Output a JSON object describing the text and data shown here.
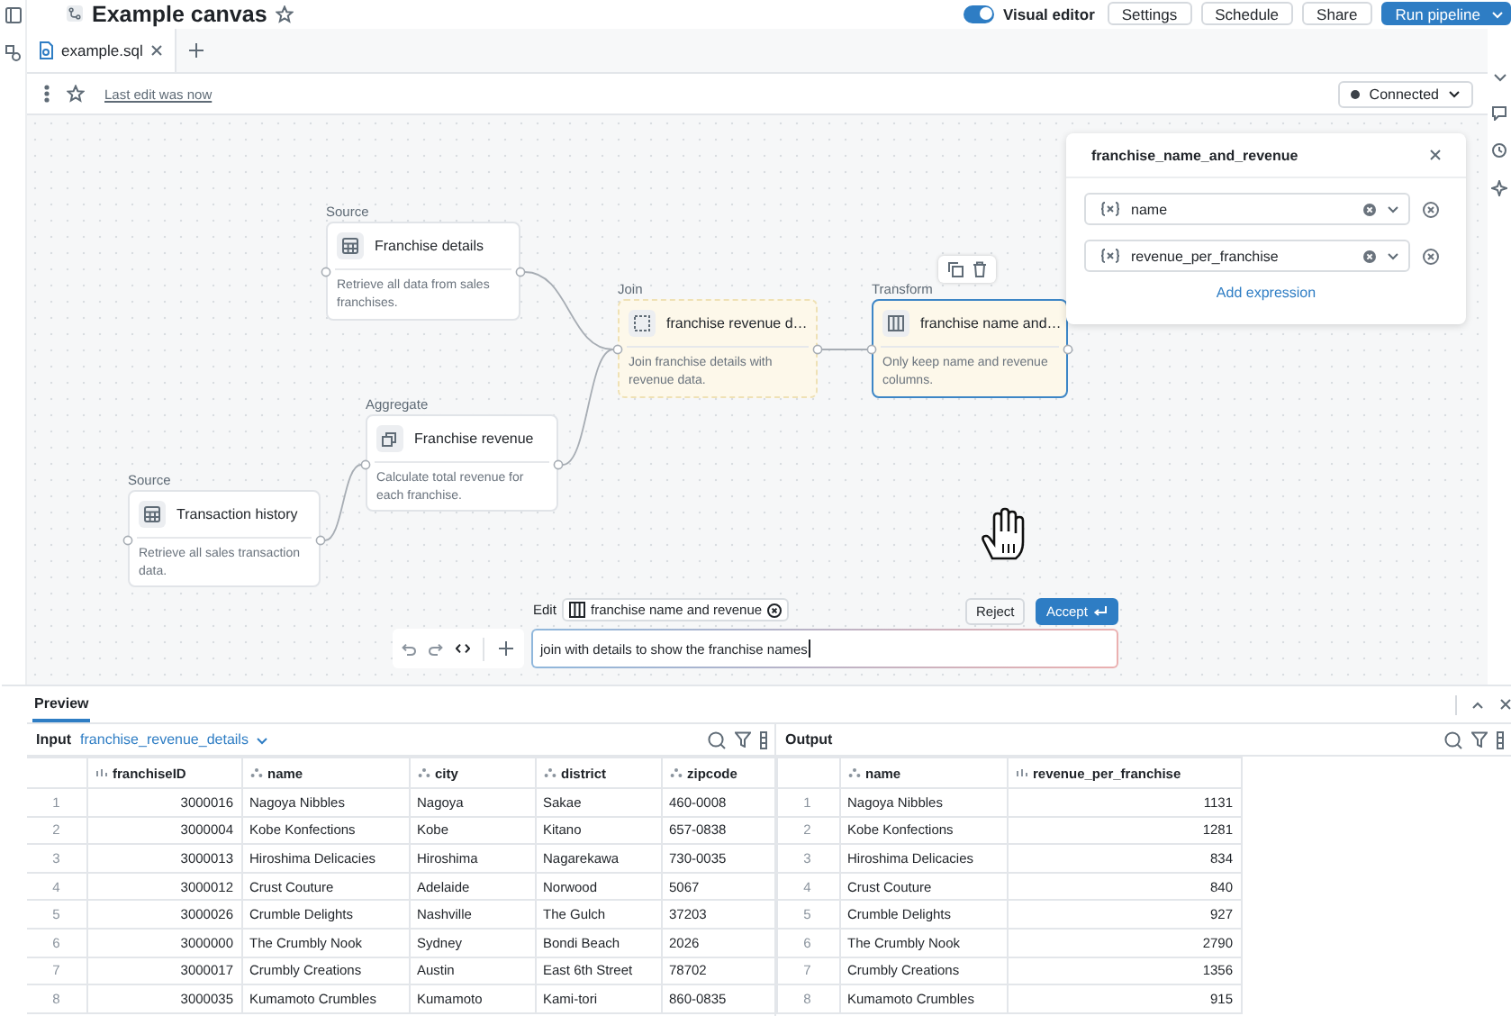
{
  "app": {
    "title": "Example canvas",
    "favorite": false,
    "visual_editor": {
      "label": "Visual editor",
      "on": true
    },
    "buttons": [
      {
        "label": "Settings",
        "kind": "default"
      },
      {
        "label": "Schedule",
        "kind": "default"
      },
      {
        "label": "Share",
        "kind": "default"
      },
      {
        "label": "Run pipeline",
        "kind": "primary"
      }
    ]
  },
  "tabs": [
    {
      "label": "example.sql",
      "selected": true
    }
  ],
  "toolbar": {
    "favorite": false,
    "last_edit": "Last edit was now",
    "connection": "Connected"
  },
  "canvas": {
    "nodes": [
      {
        "category": "Source",
        "title": "Franchise details",
        "description": "Retrieve all data from sales franchises.",
        "kind": "source",
        "pending": false,
        "selected": false
      },
      {
        "category": "Join",
        "title": "franchise revenue d…",
        "description": "Join franchise details with revenue data.",
        "kind": "join",
        "pending": true,
        "selected": false
      },
      {
        "category": "Transform",
        "title": "franchise name and…",
        "description": "Only keep name and revenue columns.",
        "kind": "transform",
        "pending": true,
        "selected": true
      },
      {
        "category": "Aggregate",
        "title": "Franchise revenue",
        "description": "Calculate total revenue for each franchise.",
        "kind": "aggregate",
        "pending": false,
        "selected": false
      },
      {
        "category": "Source",
        "title": "Transaction history",
        "description": "Retrieve all sales transaction data.",
        "kind": "source",
        "pending": false,
        "selected": false
      }
    ],
    "panel": {
      "title": "franchise_name_and_revenue",
      "expressions": [
        {
          "name": "name"
        },
        {
          "name": "revenue_per_franchise"
        }
      ],
      "add_label": "Add expression"
    },
    "edit": {
      "label": "Edit",
      "chip": "franchise name and revenue",
      "reject": "Reject",
      "accept": "Accept",
      "prompt": "join with details to show the franchise names"
    }
  },
  "preview": {
    "tabs": [
      {
        "label": "Preview",
        "selected": true
      }
    ],
    "input": {
      "label": "Input",
      "source": "franchise_revenue_details",
      "columns": [
        {
          "name": "franchiseID",
          "kind": "number"
        },
        {
          "name": "name",
          "kind": "string"
        },
        {
          "name": "city",
          "kind": "string"
        },
        {
          "name": "district",
          "kind": "string"
        },
        {
          "name": "zipcode",
          "kind": "string"
        }
      ],
      "rows": [
        {
          "number": "1",
          "cells": [
            "3000016",
            "Nagoya Nibbles",
            "Nagoya",
            "Sakae",
            "460-0008"
          ]
        },
        {
          "number": "2",
          "cells": [
            "3000004",
            "Kobe Konfections",
            "Kobe",
            "Kitano",
            "657-0838"
          ]
        },
        {
          "number": "3",
          "cells": [
            "3000013",
            "Hiroshima Delicacies",
            "Hiroshima",
            "Nagarekawa",
            "730-0035"
          ]
        },
        {
          "number": "4",
          "cells": [
            "3000012",
            "Crust Couture",
            "Adelaide",
            "Norwood",
            "5067"
          ]
        },
        {
          "number": "5",
          "cells": [
            "3000026",
            "Crumble Delights",
            "Nashville",
            "The Gulch",
            "37203"
          ]
        },
        {
          "number": "6",
          "cells": [
            "3000000",
            "The Crumbly Nook",
            "Sydney",
            "Bondi Beach",
            "2026"
          ]
        },
        {
          "number": "7",
          "cells": [
            "3000017",
            "Crumbly Creations",
            "Austin",
            "East 6th Street",
            "78702"
          ]
        },
        {
          "number": "8",
          "cells": [
            "3000035",
            "Kumamoto Crumbles",
            "Kumamoto",
            "Kami-tori",
            "860-0835"
          ]
        }
      ]
    },
    "output": {
      "label": "Output",
      "columns": [
        {
          "name": "name",
          "kind": "string"
        },
        {
          "name": "revenue_per_franchise",
          "kind": "number"
        }
      ],
      "rows": [
        {
          "number": "1",
          "cells": [
            "Nagoya Nibbles",
            "1131"
          ]
        },
        {
          "number": "2",
          "cells": [
            "Kobe Konfections",
            "1281"
          ]
        },
        {
          "number": "3",
          "cells": [
            "Hiroshima Delicacies",
            "834"
          ]
        },
        {
          "number": "4",
          "cells": [
            "Crust Couture",
            "840"
          ]
        },
        {
          "number": "5",
          "cells": [
            "Crumble Delights",
            "927"
          ]
        },
        {
          "number": "6",
          "cells": [
            "The Crumbly Nook",
            "2790"
          ]
        },
        {
          "number": "7",
          "cells": [
            "Crumbly Creations",
            "1356"
          ]
        },
        {
          "number": "8",
          "cells": [
            "Kumamoto Crumbles",
            "915"
          ]
        }
      ]
    }
  }
}
